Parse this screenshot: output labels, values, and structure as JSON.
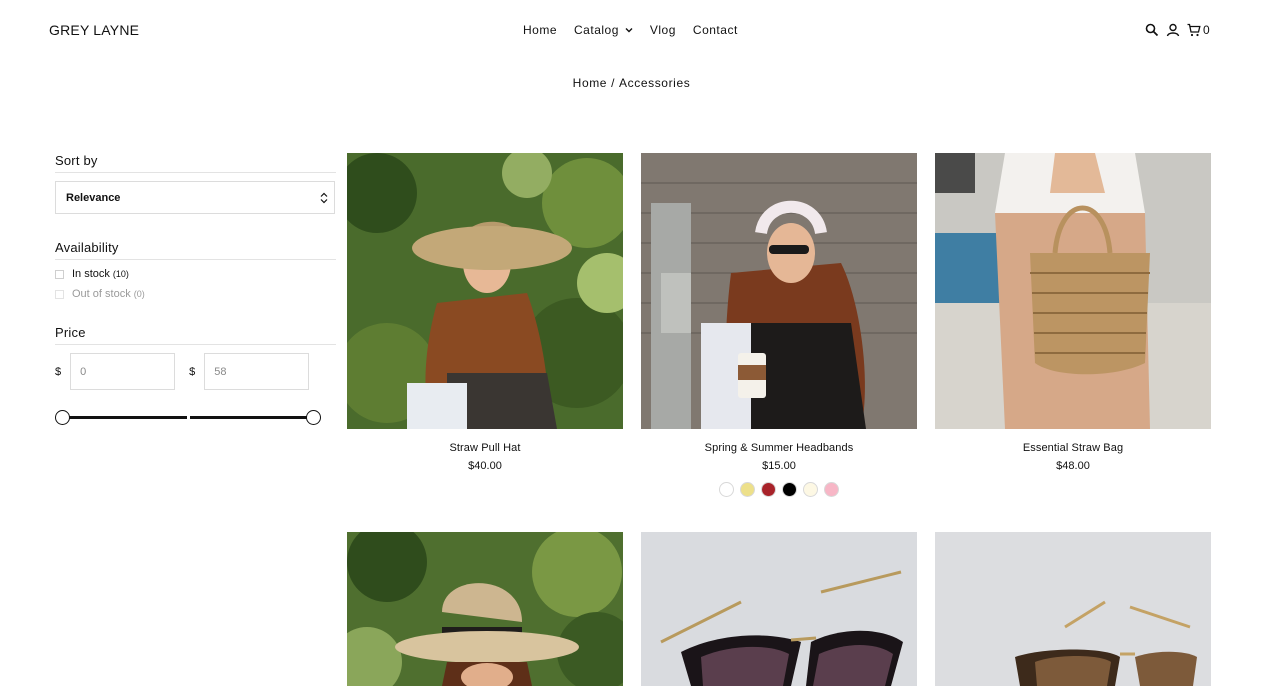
{
  "header": {
    "logo": "GREY LAYNE",
    "nav": [
      {
        "label": "Home"
      },
      {
        "label": "Catalog"
      },
      {
        "label": "Vlog"
      },
      {
        "label": "Contact"
      }
    ],
    "cart_count": "0",
    "icons": [
      "search-icon",
      "account-icon",
      "cart-icon",
      "chevron-down-icon"
    ]
  },
  "breadcrumb": {
    "home": "Home",
    "separator": "/",
    "current": "Accessories"
  },
  "sidebar": {
    "sort": {
      "heading": "Sort by",
      "selected": "Relevance"
    },
    "availability": {
      "heading": "Availability",
      "options": [
        {
          "label": "In stock",
          "count": "(10)",
          "enabled": true
        },
        {
          "label": "Out of stock",
          "count": "(0)",
          "enabled": false
        }
      ]
    },
    "price": {
      "heading": "Price",
      "currency": "$",
      "min_placeholder": "0",
      "max_placeholder": "58"
    }
  },
  "products": [
    {
      "title": "Straw Pull Hat",
      "price": "$40.00"
    },
    {
      "title": "Spring & Summer Headbands",
      "price": "$15.00",
      "swatches": [
        "#ffffff",
        "#ede08a",
        "#a8232a",
        "#000000",
        "#fdf8e4",
        "#f7b6c6"
      ]
    },
    {
      "title": "Essential Straw Bag",
      "price": "$48.00"
    },
    {
      "title": "",
      "price": ""
    },
    {
      "title": "",
      "price": ""
    },
    {
      "title": "",
      "price": ""
    }
  ],
  "colors": {
    "text": "#111111",
    "border": "#dcdcdc"
  }
}
